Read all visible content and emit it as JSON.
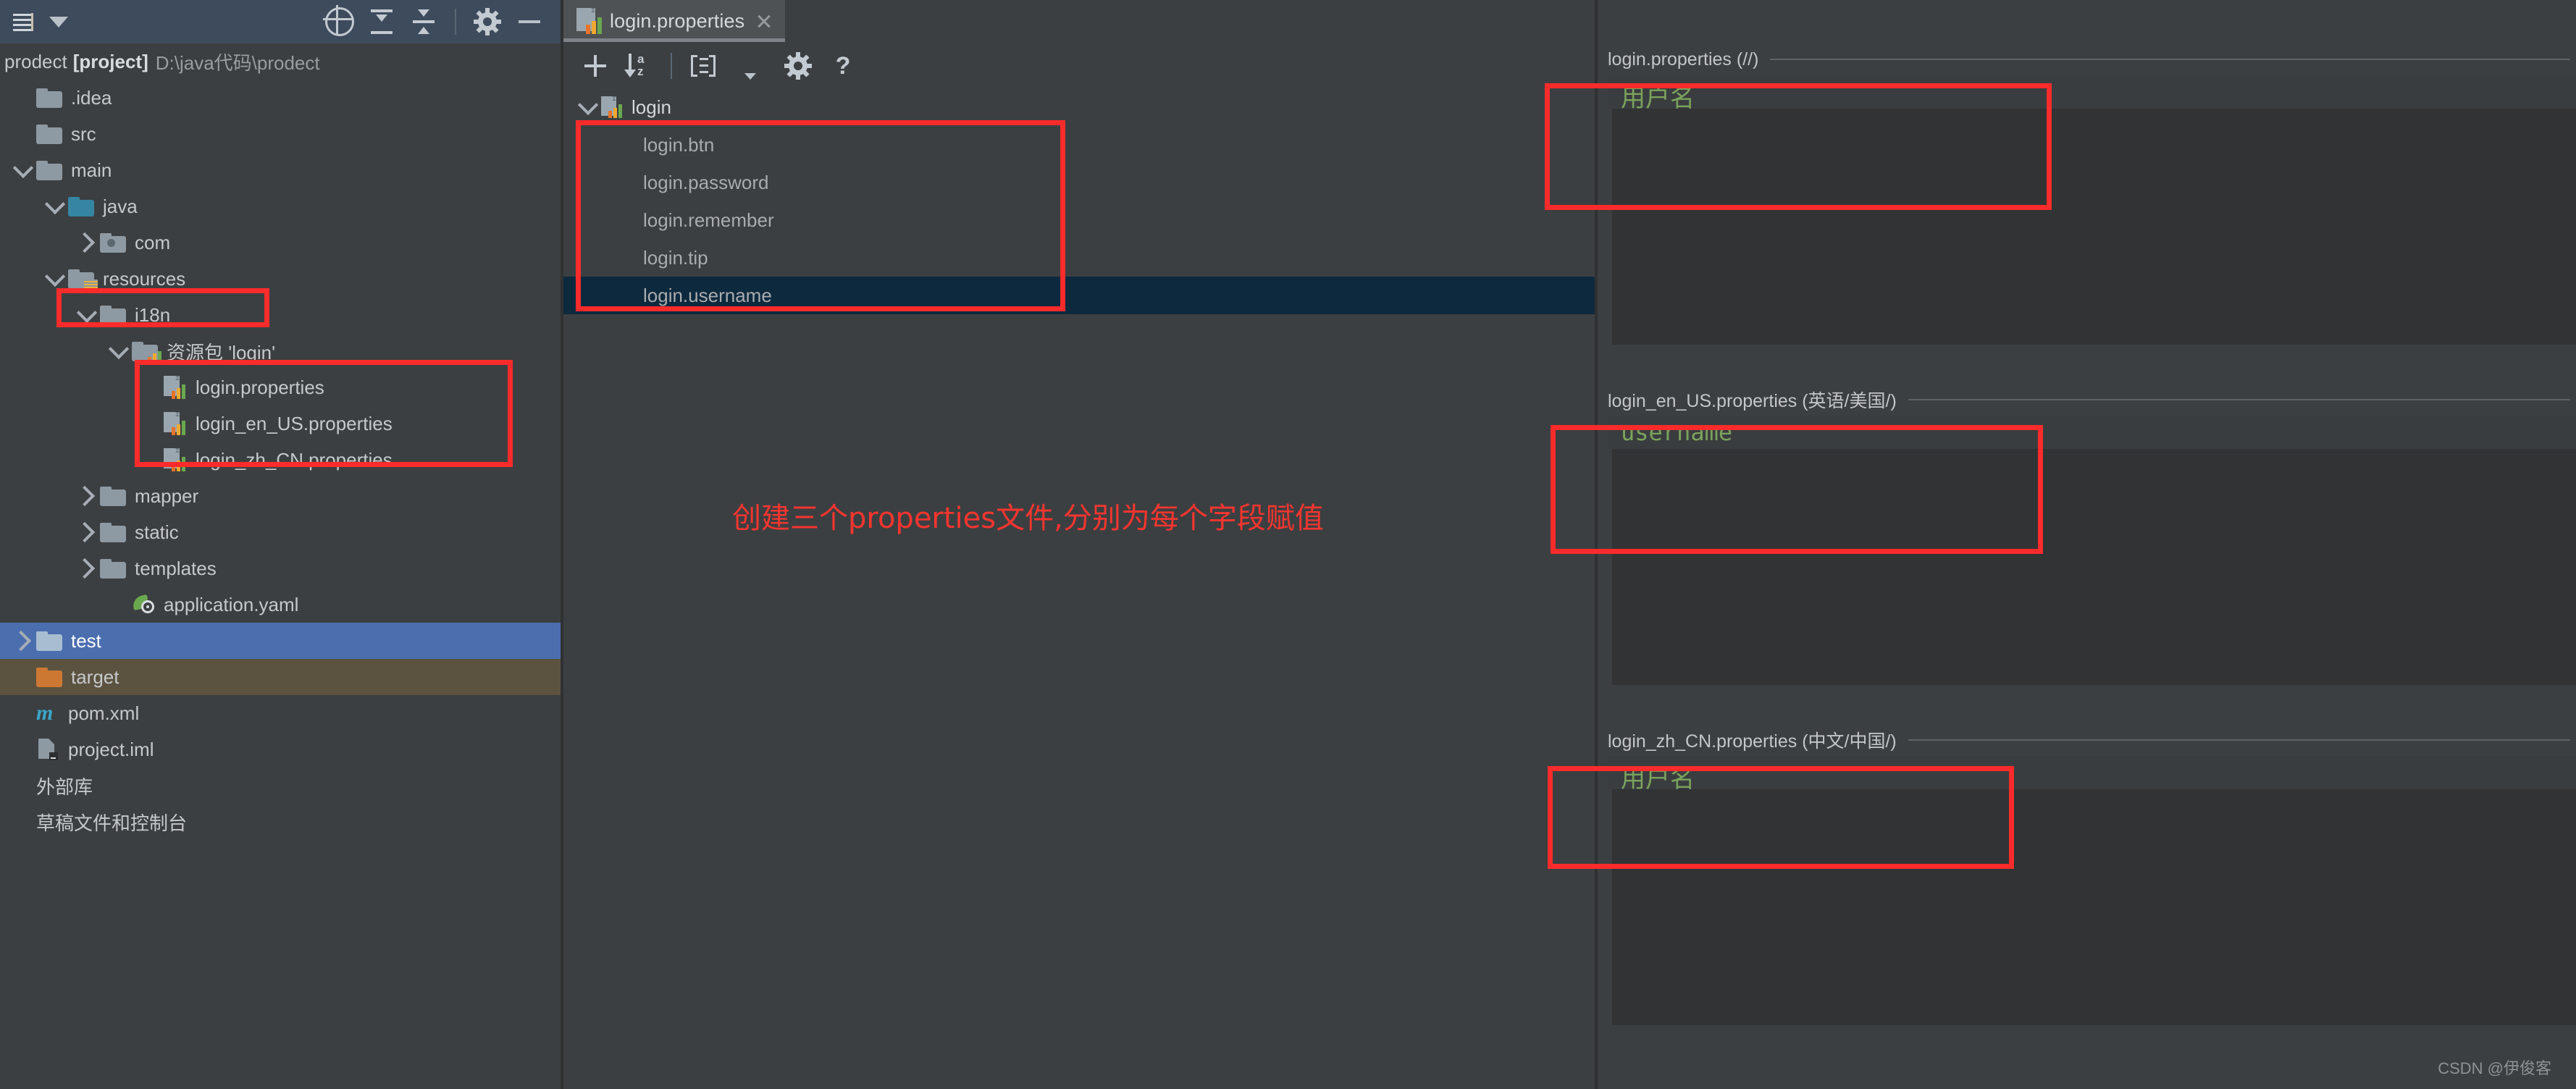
{
  "window": {
    "app": "IntelliJ IDEA",
    "watermark": "CSDN @伊俊客"
  },
  "project_toolbar": {
    "menu_icon": "list-icon",
    "dropdown_icon": "chevron-down-icon",
    "buttons": [
      {
        "name": "locate-icon",
        "tooltip": "Select Opened File"
      },
      {
        "name": "collapse-all-icon",
        "tooltip": "Collapse All"
      },
      {
        "name": "expand-all-icon",
        "tooltip": "Expand All"
      },
      {
        "name": "settings-gear-icon",
        "tooltip": "Settings"
      },
      {
        "name": "hide-icon",
        "tooltip": "Hide"
      }
    ]
  },
  "editor_tab": {
    "icon": "properties-file-icon",
    "label": "login.properties",
    "close_icon": "close-icon"
  },
  "project_panel": {
    "title_name": "prodect",
    "title_tag": "[project]",
    "title_path": "D:\\java代码\\prodect",
    "tree": [
      {
        "label": ".idea",
        "indent": 0,
        "twist": "none",
        "icon": "folder",
        "color": "grey"
      },
      {
        "label": "src",
        "indent": 0,
        "twist": "none",
        "icon": "folder",
        "color": "grey"
      },
      {
        "label": "main",
        "indent": 0,
        "twist": "down",
        "icon": "folder",
        "color": "grey"
      },
      {
        "label": "java",
        "indent": 1,
        "twist": "down",
        "icon": "folder",
        "color": "blue"
      },
      {
        "label": "com",
        "indent": 2,
        "twist": "right",
        "icon": "folder-dot",
        "color": "grey"
      },
      {
        "label": "resources",
        "indent": 1,
        "twist": "down",
        "icon": "folder-src",
        "color": "grey"
      },
      {
        "label": "i18n",
        "indent": 2,
        "twist": "down",
        "icon": "folder",
        "color": "grey"
      },
      {
        "label": "资源包 'login'",
        "indent": 3,
        "twist": "down",
        "icon": "folder-bundle",
        "color": "grey"
      },
      {
        "label": "login.properties",
        "indent": 4,
        "twist": "none",
        "icon": "properties-file",
        "color": "grey"
      },
      {
        "label": "login_en_US.properties",
        "indent": 4,
        "twist": "none",
        "icon": "properties-file",
        "color": "grey"
      },
      {
        "label": "login_zh_CN.properties",
        "indent": 4,
        "twist": "none",
        "icon": "properties-file",
        "color": "grey"
      },
      {
        "label": "mapper",
        "indent": 2,
        "twist": "right",
        "icon": "folder",
        "color": "grey"
      },
      {
        "label": "static",
        "indent": 2,
        "twist": "right",
        "icon": "folder",
        "color": "grey"
      },
      {
        "label": "templates",
        "indent": 2,
        "twist": "right",
        "icon": "folder",
        "color": "grey"
      },
      {
        "label": "application.yaml",
        "indent": 3,
        "twist": "none",
        "icon": "yaml-file",
        "color": "grey"
      },
      {
        "label": "test",
        "indent": 0,
        "twist": "right",
        "icon": "folder",
        "color": "lightblue",
        "state": "selected"
      },
      {
        "label": "target",
        "indent": 0,
        "twist": "none",
        "icon": "folder",
        "color": "orange",
        "state": "excluded"
      },
      {
        "label": "pom.xml",
        "indent": 0,
        "twist": "none",
        "icon": "maven-file",
        "color": "grey"
      },
      {
        "label": "project.iml",
        "indent": 0,
        "twist": "none",
        "icon": "iml-file",
        "color": "grey"
      },
      {
        "label": "外部库",
        "indent": 0,
        "twist": "none",
        "icon": "none",
        "color": "grey"
      },
      {
        "label": "草稿文件和控制台",
        "indent": 0,
        "twist": "none",
        "icon": "none",
        "color": "grey"
      }
    ]
  },
  "bundle_editor": {
    "toolbar": [
      {
        "name": "add-property-icon",
        "label": "+"
      },
      {
        "name": "sort-alphabetically-icon",
        "label": "AZ"
      },
      {
        "name": "group-by-prefix-icon",
        "label": "group"
      },
      {
        "name": "chevron-down-icon",
        "label": "more"
      },
      {
        "name": "settings-gear-icon",
        "label": "settings"
      },
      {
        "name": "help-icon",
        "label": "?"
      }
    ],
    "root_key": "login",
    "keys": [
      {
        "label": "login.btn",
        "selected": false
      },
      {
        "label": "login.password",
        "selected": false
      },
      {
        "label": "login.remember",
        "selected": false
      },
      {
        "label": "login.tip",
        "selected": false
      },
      {
        "label": "login.username",
        "selected": true
      }
    ]
  },
  "value_panel": {
    "sections": [
      {
        "header": "login.properties (//)",
        "value": "用户名",
        "mono": false
      },
      {
        "header": "login_en_US.properties (英语/美国/)",
        "value": "username",
        "mono": true
      },
      {
        "header": "login_zh_CN.properties (中文/中国/)",
        "value": "用户名",
        "mono": false
      }
    ]
  },
  "annotations": {
    "note": "创建三个properties文件,分别为每个字段赋值",
    "color": "#f5352f",
    "boxes": [
      {
        "name": "i18n-folder-highlight"
      },
      {
        "name": "properties-files-highlight"
      },
      {
        "name": "keys-list-highlight"
      },
      {
        "name": "default-value-highlight"
      },
      {
        "name": "en-us-value-highlight"
      },
      {
        "name": "zh-cn-value-highlight"
      }
    ]
  }
}
